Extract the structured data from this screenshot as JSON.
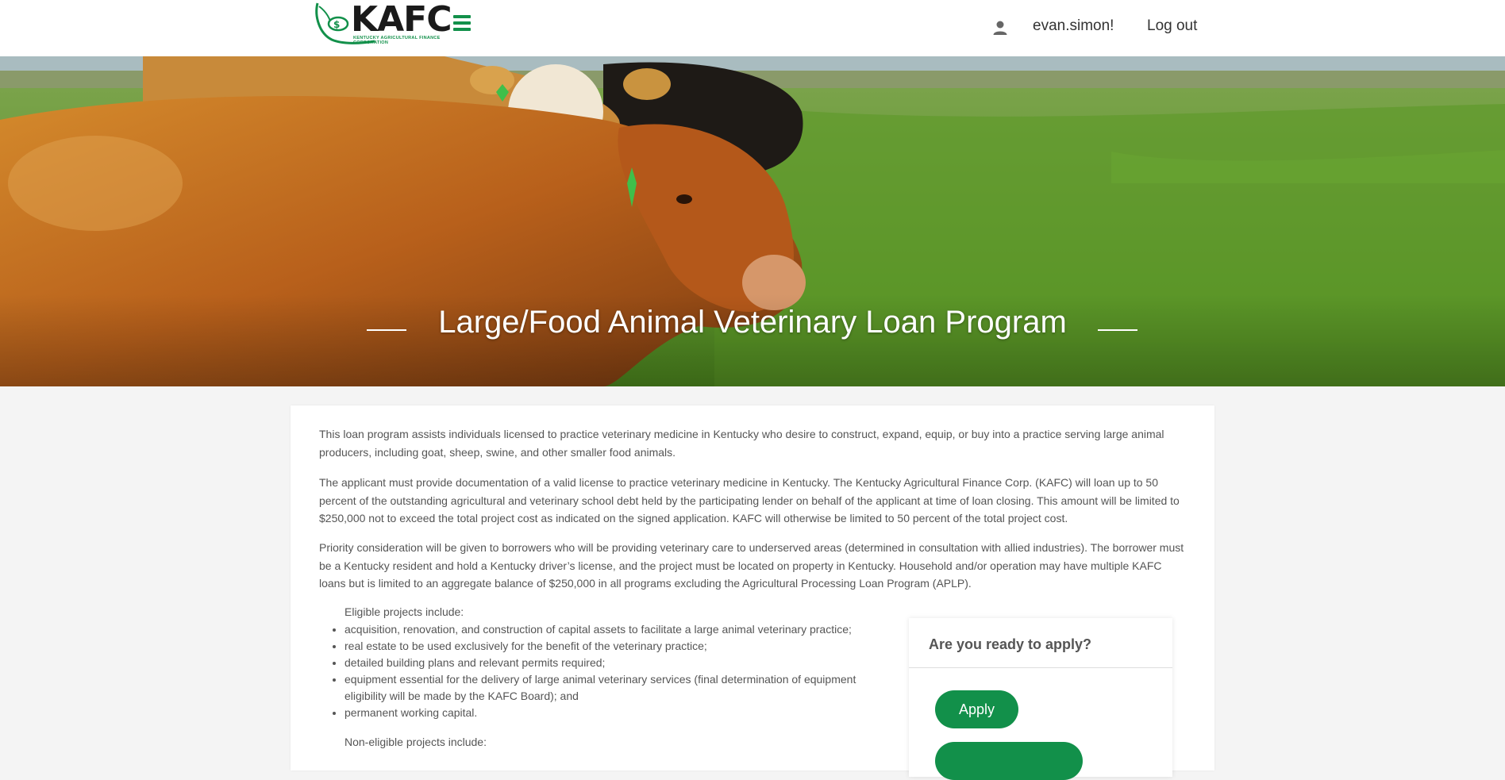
{
  "header": {
    "logo_text": "KAFC",
    "logo_sub": "KENTUCKY AGRICULTURAL FINANCE CORPORATION",
    "username": "evan.simon!",
    "logout_label": "Log out",
    "icons": {
      "menu": "hamburger-menu-icon",
      "user": "person-icon"
    },
    "brand_color": "#12904a"
  },
  "hero": {
    "title": "Large/Food Animal Veterinary Loan Program"
  },
  "content": {
    "paragraphs": [
      "This loan program assists individuals licensed to practice veterinary medicine in Kentucky who desire to construct, expand, equip, or buy into a practice serving large animal producers, including goat, sheep, swine, and other smaller food animals.",
      "The applicant must provide documentation of a valid license to practice veterinary medicine in Kentucky. The Kentucky Agricultural Finance Corp. (KAFC) will loan up to 50 percent of the outstanding agricultural and veterinary school debt held by the participating lender on behalf of the applicant at time of loan closing. This amount will be limited to $250,000 not to exceed the total project cost as indicated on the signed application. KAFC will otherwise be limited to 50 percent of the total project cost.",
      "Priority consideration will be given to borrowers who will be providing veterinary care to underserved areas (determined in consultation with allied industries). The borrower must be a Kentucky resident and hold a Kentucky driver’s license, and the project must be located on property in Kentucky. Household and/or operation may have multiple KAFC loans but is limited to an aggregate balance of $250,000 in all programs excluding the Agricultural Processing Loan Program (APLP)."
    ],
    "eligible_heading": "Eligible projects include:",
    "eligible_items": [
      "acquisition, renovation, and construction of capital assets to facilitate a large animal veterinary practice;",
      "real estate to be used exclusively for the benefit of the veterinary practice;",
      "detailed building plans and relevant permits required;",
      "equipment essential for the delivery of large animal veterinary services (final determination of equipment eligibility will be made by the KAFC Board); and",
      "permanent working capital."
    ],
    "non_eligible_heading": "Non-eligible projects include:"
  },
  "apply_box": {
    "title": "Are you ready to apply?",
    "apply_label": "Apply",
    "second_label": ""
  }
}
